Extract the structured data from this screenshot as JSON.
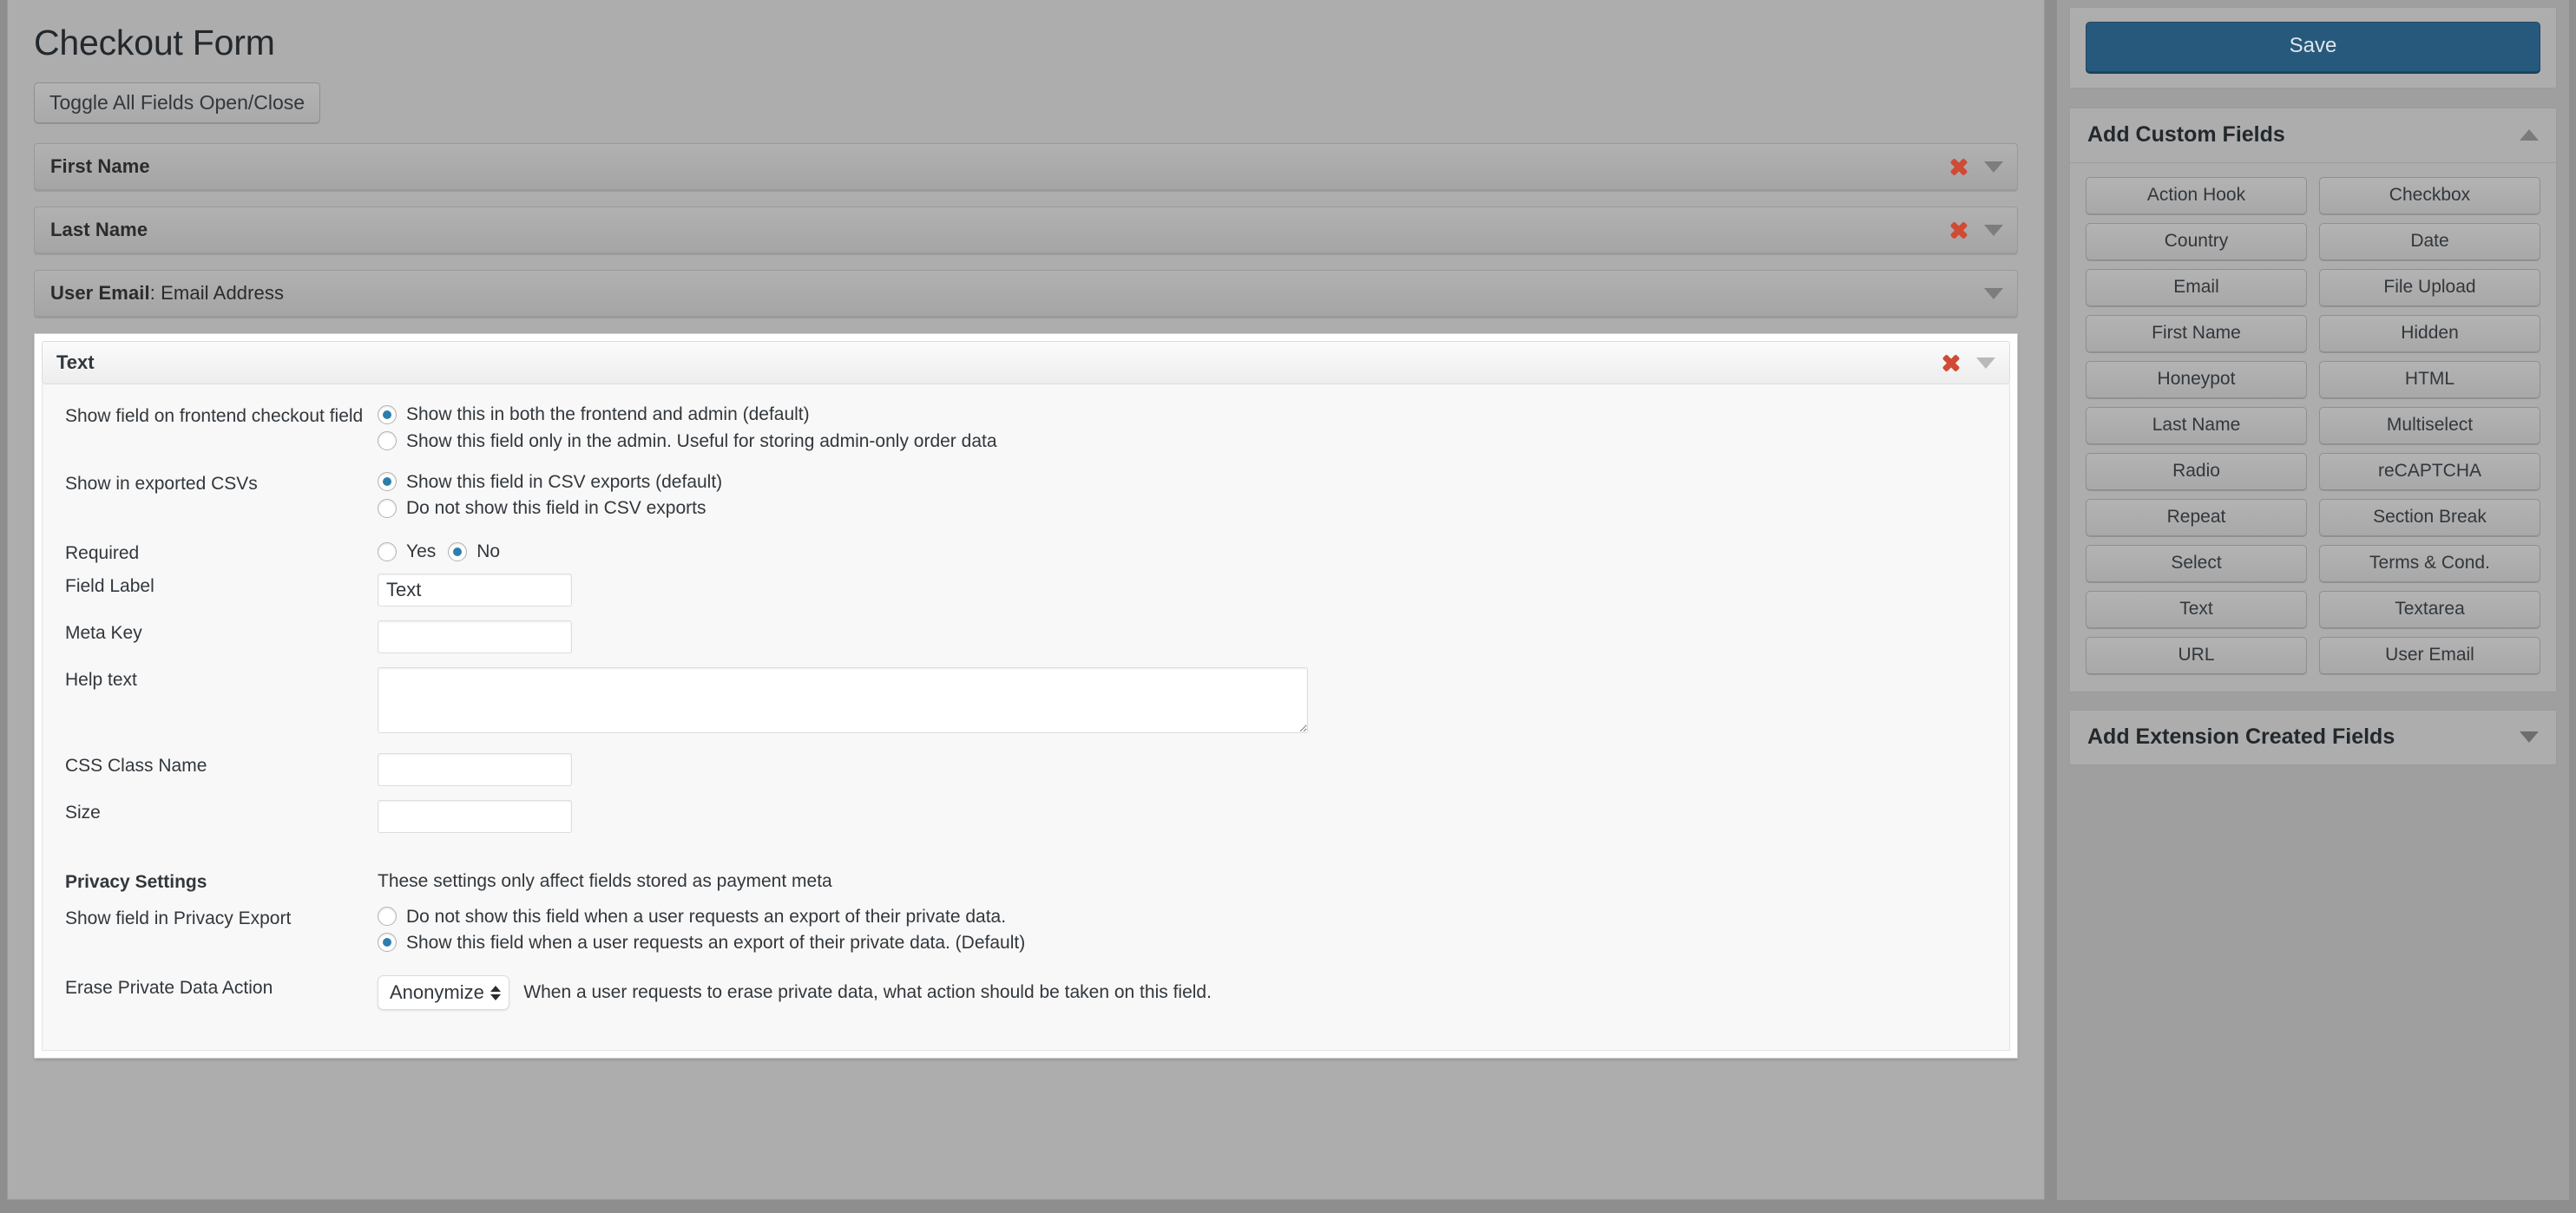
{
  "main": {
    "page_title": "Checkout Form",
    "toggle_all_label": "Toggle All Fields Open/Close",
    "collapsed_fields": [
      {
        "title": "First Name",
        "subtitle": "",
        "deletable": true
      },
      {
        "title": "Last Name",
        "subtitle": "",
        "deletable": true
      },
      {
        "title": "User Email",
        "subtitle": ": Email Address",
        "deletable": false
      }
    ],
    "open_field": {
      "header_title": "Text",
      "settings": {
        "frontend": {
          "label": "Show field on frontend checkout field",
          "options": [
            "Show this in both the frontend and admin (default)",
            "Show this field only in the admin. Useful for storing admin-only order data"
          ],
          "selected_index": 0
        },
        "csv": {
          "label": "Show in exported CSVs",
          "options": [
            "Show this field in CSV exports (default)",
            "Do not show this field in CSV exports"
          ],
          "selected_index": 0
        },
        "required": {
          "label": "Required",
          "options": [
            "Yes",
            "No"
          ],
          "selected_index": 1
        },
        "field_label": {
          "label": "Field Label",
          "value": "Text",
          "placeholder": ""
        },
        "meta_key": {
          "label": "Meta Key",
          "value": "",
          "placeholder": ""
        },
        "help_text": {
          "label": "Help text",
          "value": "",
          "placeholder": ""
        },
        "css_class": {
          "label": "CSS Class Name",
          "value": "",
          "placeholder": ""
        },
        "size": {
          "label": "Size",
          "value": "",
          "placeholder": ""
        },
        "privacy": {
          "heading": "Privacy Settings",
          "note": "These settings only affect fields stored as payment meta",
          "export": {
            "label": "Show field in Privacy Export",
            "options": [
              "Do not show this field when a user requests an export of their private data.",
              "Show this field when a user requests an export of their private data. (Default)"
            ],
            "selected_index": 1
          },
          "erase": {
            "label": "Erase Private Data Action",
            "selected_option": "Anonymize",
            "hint": "When a user requests to erase private data, what action should be taken on this field."
          }
        }
      }
    }
  },
  "sidebar": {
    "save_label": "Save",
    "custom_fields_panel": {
      "title": "Add Custom Fields",
      "collapsed": false,
      "chips": [
        "Action Hook",
        "Checkbox",
        "Country",
        "Date",
        "Email",
        "File Upload",
        "First Name",
        "Hidden",
        "Honeypot",
        "HTML",
        "Last Name",
        "Multiselect",
        "Radio",
        "reCAPTCHA",
        "Repeat",
        "Section Break",
        "Select",
        "Terms & Cond.",
        "Text",
        "Textarea",
        "URL",
        "User Email"
      ]
    },
    "extension_panel": {
      "title": "Add Extension Created Fields",
      "collapsed": true
    }
  },
  "colors": {
    "accent_blue": "#27597c",
    "radio_selected": "#2d7ead",
    "delete_red": "#d04a35",
    "panel_gray": "#adadad",
    "body_gray": "#8e8e8e"
  }
}
